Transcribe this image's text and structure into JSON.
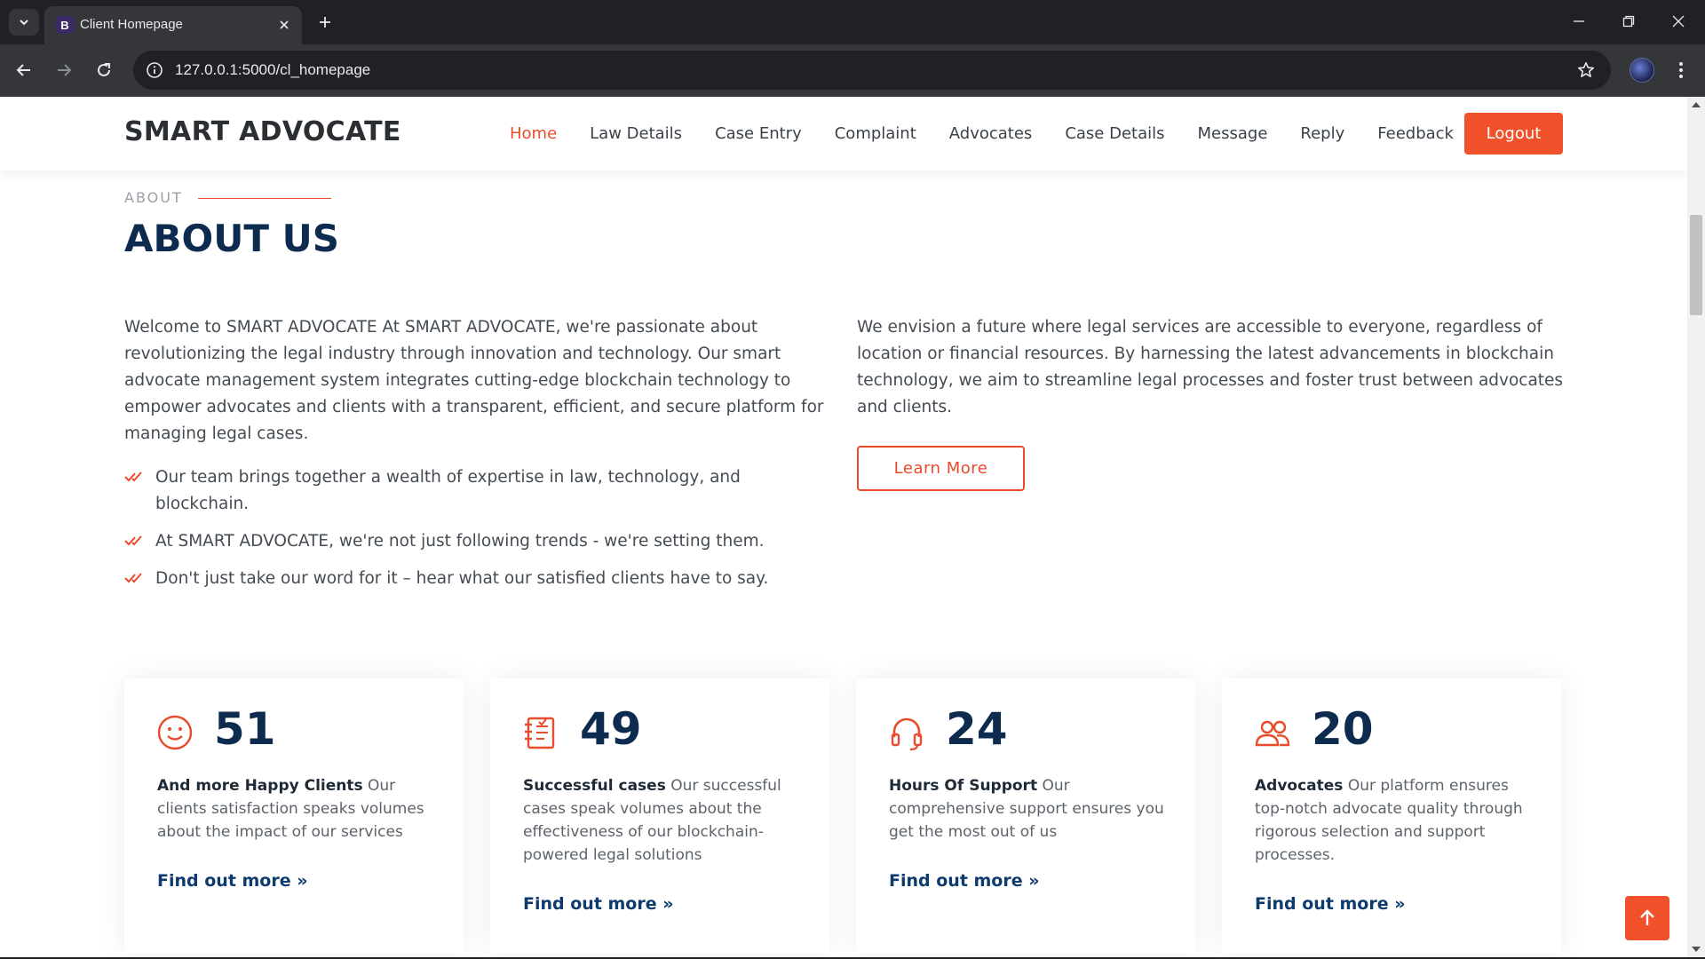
{
  "browser": {
    "tab_title": "Client Homepage",
    "tab_favicon_letter": "B",
    "url": "127.0.0.1:5000/cl_homepage"
  },
  "header": {
    "brand": "SMART ADVOCATE",
    "nav": [
      "Home",
      "Law Details",
      "Case Entry",
      "Complaint",
      "Advocates",
      "Case Details",
      "Message",
      "Reply",
      "Feedback"
    ],
    "active_nav": "Home",
    "logout_label": "Logout"
  },
  "about": {
    "eyebrow": "ABOUT",
    "title": "ABOUT US",
    "intro": "Welcome to SMART ADVOCATE At SMART ADVOCATE, we're passionate about revolutionizing the legal industry through innovation and technology. Our smart advocate management system integrates cutting-edge blockchain technology to empower advocates and clients with a transparent, efficient, and secure platform for managing legal cases.",
    "bullets": [
      "Our team brings together a wealth of expertise in law, technology, and blockchain.",
      "At SMART ADVOCATE, we're not just following trends - we're setting them.",
      "Don't just take our word for it – hear what our satisfied clients have to say."
    ],
    "vision": "We envision a future where legal services are accessible to everyone, regardless of location or financial resources. By harnessing the latest advancements in blockchain technology, we aim to streamline legal processes and foster trust between advocates and clients.",
    "learn_more_label": "Learn More"
  },
  "stats": [
    {
      "icon": "smiley-icon",
      "number": "51",
      "title": "And more Happy Clients",
      "text": "Our clients satisfaction speaks volumes about the impact of our services",
      "link": "Find out more »"
    },
    {
      "icon": "journal-icon",
      "number": "49",
      "title": "Successful cases",
      "text": "Our successful cases speak volumes about the effectiveness of our blockchain-powered legal solutions",
      "link": "Find out more »"
    },
    {
      "icon": "headset-icon",
      "number": "24",
      "title": "Hours Of Support",
      "text": "Our comprehensive support ensures you get the most out of us",
      "link": "Find out more »"
    },
    {
      "icon": "people-icon",
      "number": "20",
      "title": "Advocates",
      "text": "Our platform ensures top-notch advocate quality through rigorous selection and support processes.",
      "link": "Find out more »"
    }
  ],
  "colors": {
    "accent": "#e84c2b",
    "navy": "#0d2a4f",
    "link": "#0d3b6e"
  }
}
